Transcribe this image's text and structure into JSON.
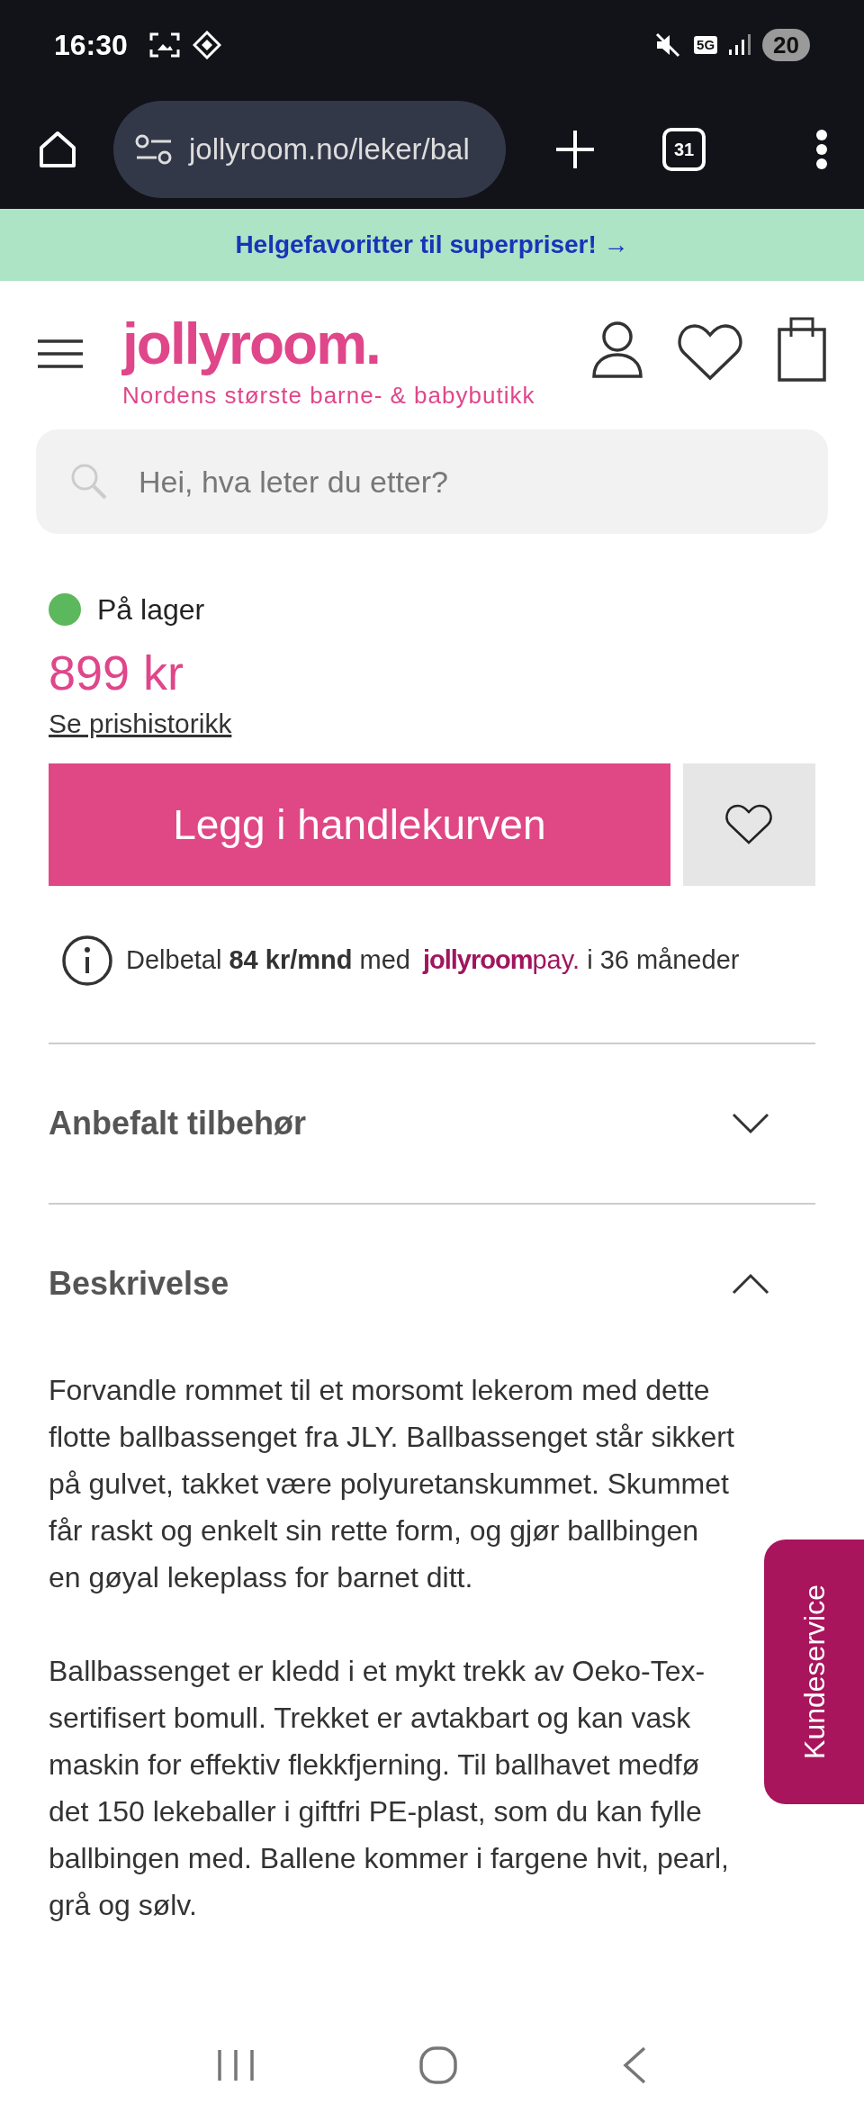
{
  "status_bar": {
    "time": "16:30",
    "network": "5G",
    "battery": "20"
  },
  "browser": {
    "url": "jollyroom.no/leker/bal",
    "tab_count": "31"
  },
  "promo_banner": {
    "text": "Helgefavoritter til superpriser! →"
  },
  "header": {
    "logo": "jollyroom.",
    "tagline": "Nordens største barne- & babybutikk"
  },
  "search": {
    "placeholder": "Hei, hva leter du etter?"
  },
  "product": {
    "stock": {
      "label": "På lager",
      "color": "#5cb85c"
    },
    "price": "899 kr",
    "price_history_link": "Se prishistorikk",
    "add_to_cart": "Legg i handlekurven",
    "installment": {
      "text": "Delbetal **84 kr/mnd** med",
      "brand_main": "jollyroom",
      "brand_suffix": "pay.",
      "text_after": "i 36 måneder"
    }
  },
  "sections": [
    {
      "title": "Anbefalt tilbehør",
      "expanded": false
    },
    {
      "title": "Beskrivelse",
      "expanded": true,
      "paragraphs": [
        [
          "Forvandle rommet til et morsomt lekerom med dette",
          "flotte ballbassenget fra JLY. Ballbassenget står sikkert",
          "på gulvet, takket være polyuretanskummet. Skummet",
          "får raskt og enkelt sin rette form, og gjør ballbingen",
          "en gøyal lekeplass for barnet ditt."
        ],
        [
          "Ballbassenget er kledd i et mykt trekk av Oeko-Tex-",
          "sertifisert bomull. Trekket er avtakbart og kan vask",
          "maskin for effektiv flekkfjerning. Til ballhavet medfø",
          "det 150 lekeballer i giftfri PE-plast, som du kan fylle",
          "ballbingen med. Ballene kommer i fargene hvit, pearl,",
          "grå og sølv."
        ]
      ]
    }
  ],
  "side_tab": {
    "label": "Kundeservice"
  }
}
